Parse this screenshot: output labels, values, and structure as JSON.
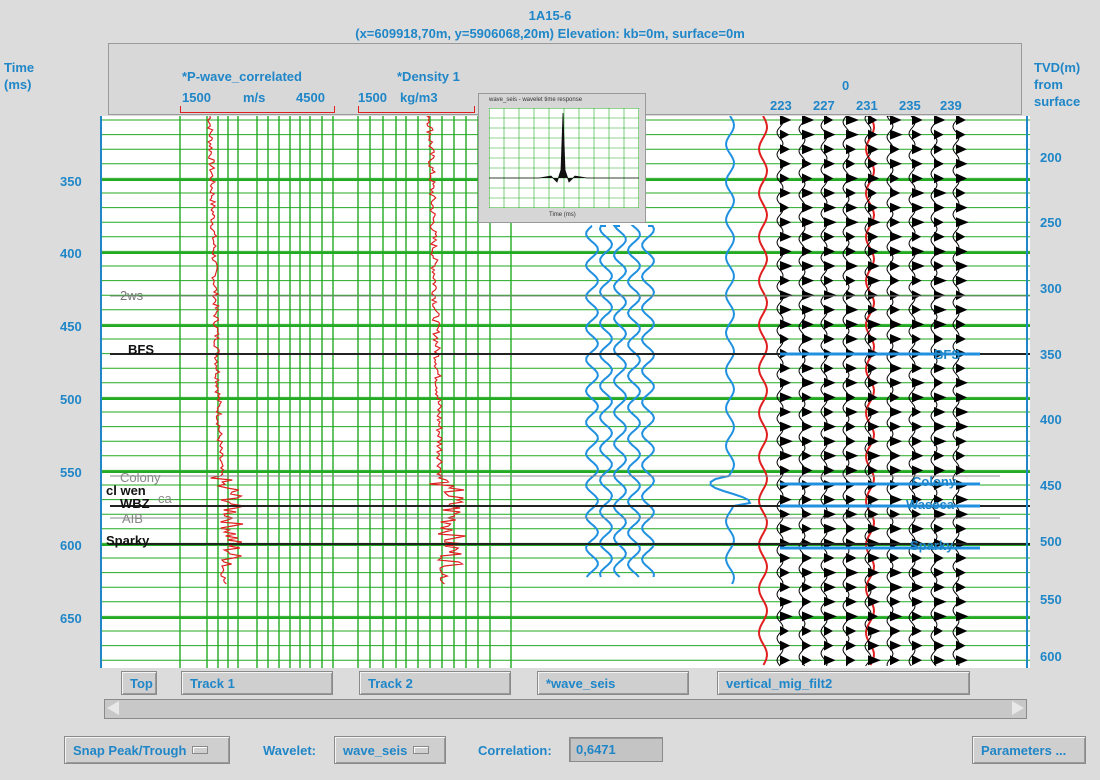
{
  "header": {
    "well_name": "1A15-6",
    "location": "(x=609918,70m, y=5906068,20m) Elevation: kb=0m, surface=0m",
    "left_axis_title_1": "Time",
    "left_axis_title_2": "(ms)",
    "right_axis_title_1": "TVD(m)",
    "right_axis_title_2": "from",
    "right_axis_title_3": "surface"
  },
  "tracks": {
    "pwave": {
      "name": "*P-wave_correlated",
      "min": "1500",
      "unit": "m/s",
      "max": "4500"
    },
    "density": {
      "name": "*Density 1",
      "min": "1500",
      "unit": "kg/m3",
      "max": ""
    },
    "seismic_header_top": "0",
    "trace_labels": [
      "223",
      "227",
      "231",
      "235",
      "239"
    ]
  },
  "popup": {
    "title": "wave_seis - wavelet time response",
    "xlabel": "Time (ms)"
  },
  "time_ticks": [
    "350",
    "400",
    "450",
    "500",
    "550",
    "600",
    "650"
  ],
  "depth_ticks": [
    "200",
    "250",
    "300",
    "350",
    "400",
    "450",
    "500",
    "550",
    "600"
  ],
  "markers_left": {
    "twows": "2ws",
    "bfs": "BFS",
    "colony": "Colony",
    "clwn": "cl wen",
    "waseca": "ca",
    "wbz": "WBZ",
    "aib": "AIB",
    "sparky": "Sparky"
  },
  "markers_right": {
    "bfs": "BFS",
    "colony": "Colony",
    "waseca": "Waseca",
    "sparky": "Sparky"
  },
  "track_buttons": {
    "top": "Top",
    "track1": "Track 1",
    "track2": "Track 2",
    "wave_seis": "*wave_seis",
    "vertical": "vertical_mig_filt2"
  },
  "controls": {
    "snap_label": "Snap Peak/Trough",
    "wavelet_label": "Wavelet:",
    "wavelet_value": "wave_seis",
    "correlation_label": "Correlation:",
    "correlation_value": "0,6471",
    "parameters_label": "Parameters ..."
  },
  "colors": {
    "accent": "#1f86c8",
    "grid": "#22aa22",
    "log": "#e02020",
    "seis_blue": "#2090e0"
  }
}
